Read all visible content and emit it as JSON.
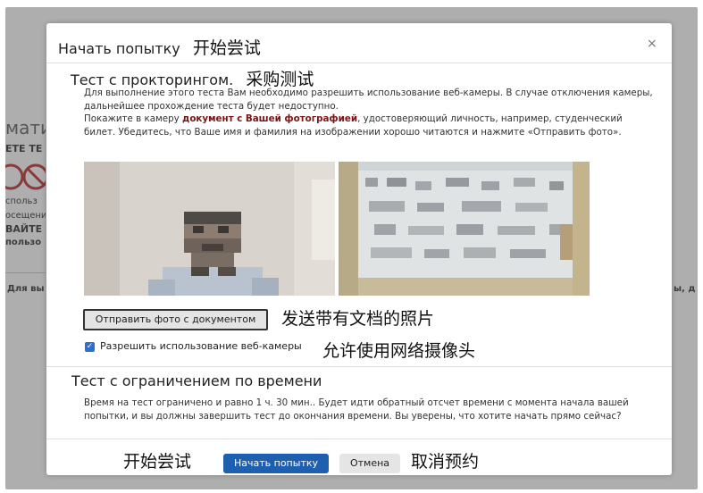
{
  "background": {
    "fragments": [
      "матик",
      "ЕТЕ ТЕ",
      "спольз",
      "осещени",
      "ВАЙТЕ",
      "пользо",
      "Для вы",
      "ы, д"
    ]
  },
  "modal": {
    "title": "Начать попытку",
    "title_cn": "开始尝试",
    "close_glyph": "×",
    "proctoring": {
      "heading": "Тест с прокторингом.",
      "heading_cn": "采购测试",
      "p1": "Для выполнение этого теста Вам необходимо разрешить использование веб-камеры. В случае отключения камеры, дальнейшее прохождение теста будет недоступно.",
      "p2_before": "Покажите в камеру ",
      "p2_bold": "документ с Вашей фотографией",
      "p2_after": ", удостоверяющий личность, например, студенческий билет. Убедитесь, что Ваше имя и фамилия на изображении хорошо читаются и нажмите «Отправить фото».",
      "send_photo_button": "Отправить фото с документом",
      "send_photo_cn": "发送带有文档的照片",
      "webcam_checkbox_label": "Разрешить использование веб-камеры",
      "webcam_checkbox_cn": "允许使用网络摄像头",
      "webcam_checked": true
    },
    "time_limit": {
      "heading": "Тест с ограничением по времени",
      "text": "Время на тест ограничено и равно 1 ч. 30 мин.. Будет идти обратный отсчет времени с момента начала вашей попытки, и вы должны завершить тест до окончания времени. Вы уверены, что хотите начать прямо сейчас?"
    },
    "footer": {
      "start_cn": "开始尝试",
      "start_button": "Начать попытку",
      "cancel_button": "Отмена",
      "cancel_cn": "取消预约"
    }
  },
  "colors": {
    "primary": "#1f5fb0",
    "checkbox": "#2f6fd1",
    "bold_link": "#7a1414",
    "backdrop": "#aeaeae"
  }
}
